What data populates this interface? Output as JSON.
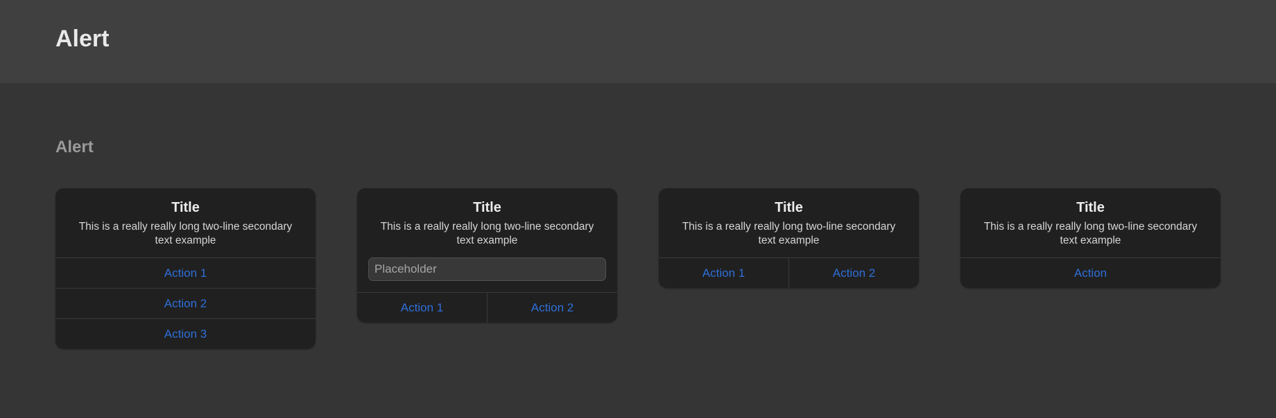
{
  "header": {
    "title": "Alert"
  },
  "section": {
    "title": "Alert"
  },
  "alerts": [
    {
      "title": "Title",
      "message": "This is a really really long two-line secondary text example",
      "actions": [
        "Action 1",
        "Action 2",
        "Action 3"
      ]
    },
    {
      "title": "Title",
      "message": "This is a really really long two-line secondary text example",
      "input_placeholder": "Placeholder",
      "actions": [
        "Action 1",
        "Action 2"
      ]
    },
    {
      "title": "Title",
      "message": "This is a really really long two-line secondary text example",
      "actions": [
        "Action 1",
        "Action 2"
      ]
    },
    {
      "title": "Title",
      "message": "This is a really really long two-line secondary text example",
      "actions": [
        "Action"
      ]
    }
  ],
  "colors": {
    "page_background": "#353535",
    "header_background": "#404040",
    "card_background": "#202020",
    "action_text": "#2f6fd8",
    "divider": "#3a3a3a"
  }
}
